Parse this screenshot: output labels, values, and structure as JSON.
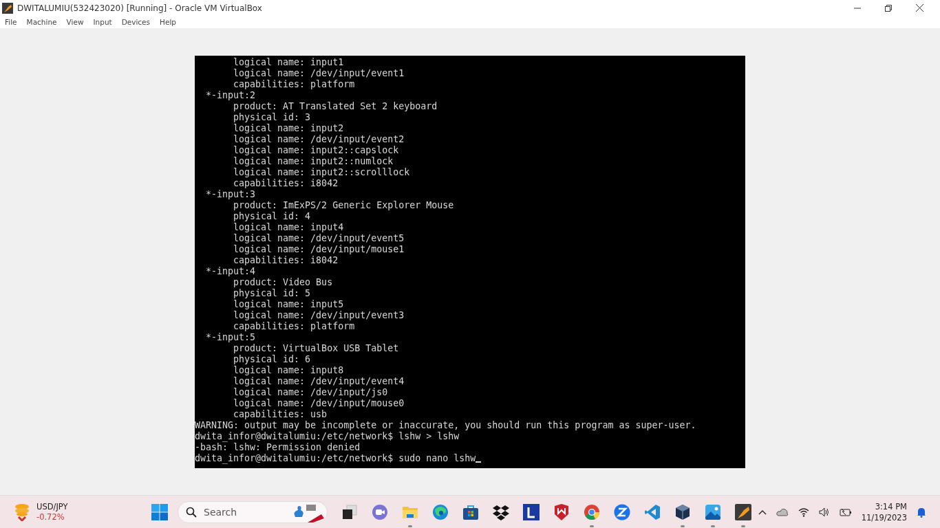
{
  "window": {
    "title": "DWITALUMIU(532423020) [Running] - Oracle VM VirtualBox"
  },
  "menu": [
    "File",
    "Machine",
    "View",
    "Input",
    "Devices",
    "Help"
  ],
  "terminal": {
    "lines": [
      "       logical name: input1",
      "       logical name: /dev/input/event1",
      "       capabilities: platform",
      "  *-input:2",
      "       product: AT Translated Set 2 keyboard",
      "       physical id: 3",
      "       logical name: input2",
      "       logical name: /dev/input/event2",
      "       logical name: input2::capslock",
      "       logical name: input2::numlock",
      "       logical name: input2::scrolllock",
      "       capabilities: i8042",
      "  *-input:3",
      "       product: ImExPS/2 Generic Explorer Mouse",
      "       physical id: 4",
      "       logical name: input4",
      "       logical name: /dev/input/event5",
      "       logical name: /dev/input/mouse1",
      "       capabilities: i8042",
      "  *-input:4",
      "       product: Video Bus",
      "       physical id: 5",
      "       logical name: input5",
      "       logical name: /dev/input/event3",
      "       capabilities: platform",
      "  *-input:5",
      "       product: VirtualBox USB Tablet",
      "       physical id: 6",
      "       logical name: input8",
      "       logical name: /dev/input/event4",
      "       logical name: /dev/input/js0",
      "       logical name: /dev/input/mouse0",
      "       capabilities: usb",
      "WARNING: output may be incomplete or inaccurate, you should run this program as super-user.",
      "dwita_infor@dwitalumiu:/etc/network$ lshw > lshw",
      "-bash: lshw: Permission denied",
      "dwita_infor@dwitalumiu:/etc/network$ sudo nano lshw"
    ]
  },
  "widget": {
    "symbol": "USD/JPY",
    "change": "-0.72%"
  },
  "search": {
    "placeholder": "Search"
  },
  "taskbar_apps": [
    {
      "kind": "taskview",
      "running": false
    },
    {
      "kind": "meet",
      "running": false
    },
    {
      "kind": "folder",
      "running": true
    },
    {
      "kind": "edge",
      "running": false
    },
    {
      "kind": "store",
      "running": false
    },
    {
      "kind": "dropbox",
      "running": false
    },
    {
      "kind": "letter",
      "running": false
    },
    {
      "kind": "shield",
      "running": false
    },
    {
      "kind": "chrome",
      "running": true
    },
    {
      "kind": "zapp",
      "running": false
    },
    {
      "kind": "code",
      "running": false
    },
    {
      "kind": "cube",
      "running": true
    },
    {
      "kind": "photos",
      "running": true
    },
    {
      "kind": "vm",
      "running": true
    }
  ],
  "clock": {
    "time": "3:14 PM",
    "date": "11/19/2023"
  }
}
